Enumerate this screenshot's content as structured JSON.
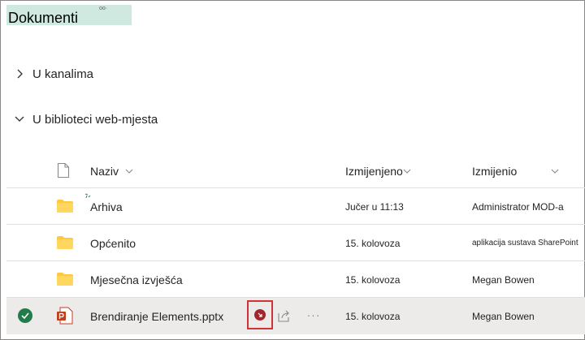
{
  "title": {
    "text": "Dokumenti",
    "badge": "oo·"
  },
  "sections": [
    {
      "label": "U kanalima",
      "expanded": false
    },
    {
      "label": "U biblioteci web-mjesta",
      "expanded": true
    }
  ],
  "columns": {
    "name": "Naziv",
    "modified": "Izmijenjeno",
    "modified_by": "Izmijenio"
  },
  "rows": [
    {
      "type": "folder",
      "name": "Arhiva",
      "modified": "Jučer u 11:13",
      "modified_by": "Administrator MOD-a"
    },
    {
      "type": "folder",
      "name": "Općenito",
      "modified": "15. kolovoza",
      "modified_by": "aplikacija sustava SharePoint"
    },
    {
      "type": "folder",
      "name": "Mjesečna izvješća",
      "modified": "15. kolovoza",
      "modified_by": "Megan Bowen"
    },
    {
      "type": "pptx",
      "name": "Brendiranje Elements.pptx",
      "modified": "15. kolovoza",
      "modified_by": "Megan Bowen",
      "selected": true
    }
  ],
  "colors": {
    "folder": "#ffc83d",
    "accent_green": "#237b4b",
    "highlight_red": "#d13438",
    "ppt": "#c43e1c"
  },
  "icons": [
    "chevron-right-icon",
    "chevron-down-icon",
    "file-icon",
    "folder-icon",
    "checkmark-icon",
    "powerpoint-icon",
    "sync-error-icon",
    "share-icon",
    "more-icon"
  ]
}
